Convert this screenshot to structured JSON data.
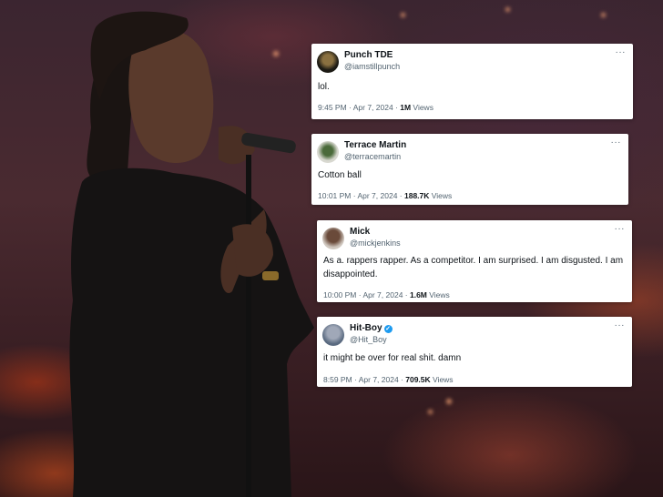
{
  "tweets": [
    {
      "name": "Punch TDE",
      "handle": "@iamstillpunch",
      "text": "lol.",
      "time": "9:45 PM · Apr 7, 2024 · ",
      "views_count": "1M",
      "views_label": " Views",
      "more": "···",
      "verified": false
    },
    {
      "name": "Terrace Martin",
      "handle": "@terracemartin",
      "text": "Cotton ball",
      "time": "10:01 PM · Apr 7, 2024 · ",
      "views_count": "188.7K",
      "views_label": " Views",
      "more": "···",
      "verified": false
    },
    {
      "name": "Mick",
      "handle": "@mickjenkins",
      "text": "As a. rappers rapper. As a competitor. I am surprised. I am disgusted. I am disappointed.",
      "time": "10:00 PM · Apr 7, 2024 · ",
      "views_count": "1.6M",
      "views_label": " Views",
      "more": "···",
      "verified": false
    },
    {
      "name": "Hit-Boy",
      "handle": "@Hit_Boy",
      "text": "it might be over for real shit. damn",
      "time": "8:59 PM · Apr 7, 2024 · ",
      "views_count": "709.5K",
      "views_label": " Views",
      "more": "···",
      "verified": true
    }
  ]
}
